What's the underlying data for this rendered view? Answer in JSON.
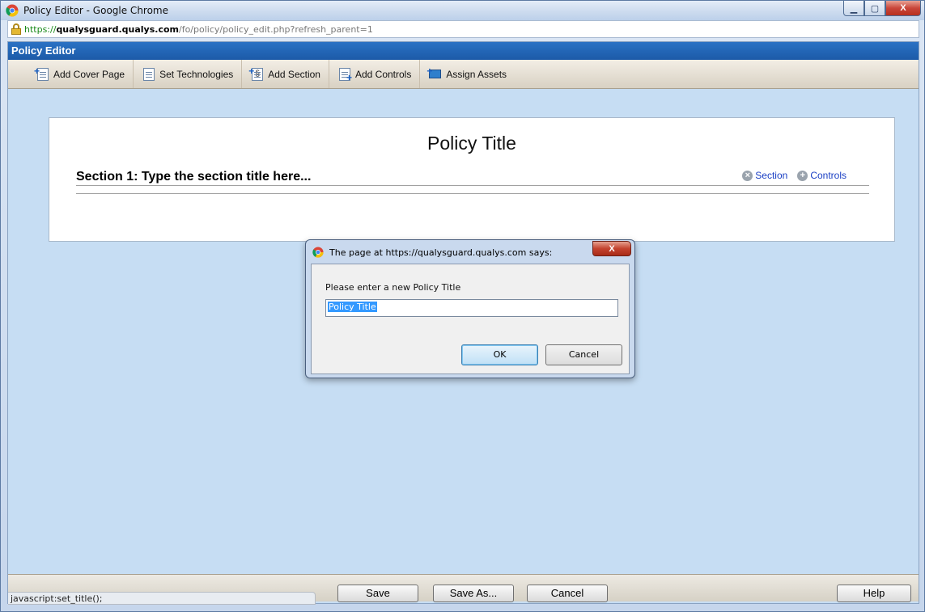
{
  "window": {
    "title": "Policy Editor - Google Chrome",
    "url_scheme": "https://",
    "url_host": "qualysguard.qualys.com",
    "url_path": "/fo/policy/policy_edit.php?refresh_parent=1"
  },
  "app": {
    "header": "Policy Editor",
    "toolbar": [
      {
        "label": "Add Cover Page",
        "icon": "add-cover-page-icon"
      },
      {
        "label": "Set Technologies",
        "icon": "set-technologies-icon"
      },
      {
        "label": "Add Section",
        "icon": "add-section-icon"
      },
      {
        "label": "Add Controls",
        "icon": "add-controls-icon"
      },
      {
        "label": "Assign Assets",
        "icon": "assign-assets-icon"
      }
    ]
  },
  "panel": {
    "policy_title": "Policy Title",
    "section_title": "Section 1: Type the section title here...",
    "section_link": "Section",
    "controls_link": "Controls"
  },
  "dialog": {
    "title": "The page at https://qualysguard.qualys.com says:",
    "close": "X",
    "message": "Please enter a new Policy Title",
    "input_value": "Policy Title",
    "ok": "OK",
    "cancel": "Cancel"
  },
  "bottom": {
    "save": "Save",
    "save_as": "Save As...",
    "cancel": "Cancel",
    "help": "Help",
    "status": "javascript:set_title();"
  },
  "colors": {
    "header_blue": "#1c5aa8",
    "page_bg": "#c6ddf3",
    "link_blue": "#1a3fc4"
  }
}
